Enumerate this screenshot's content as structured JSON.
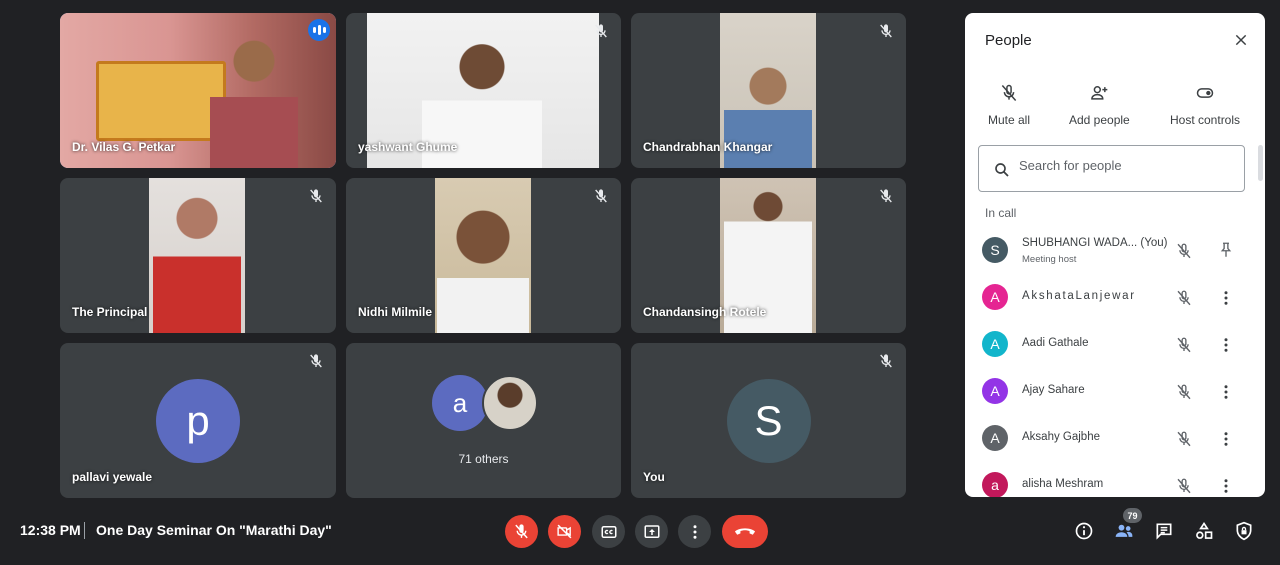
{
  "participants": [
    {
      "name": "Dr. Vilas G. Petkar",
      "speaking": true
    },
    {
      "name": "yashwant Ghume",
      "muted": true
    },
    {
      "name": "Chandrabhan Khangar",
      "muted": true
    },
    {
      "name": "The Principal",
      "muted": true
    },
    {
      "name": "Nidhi Milmile",
      "muted": true
    },
    {
      "name": "Chandansingh Rotele",
      "muted": true
    },
    {
      "name": "pallavi yewale",
      "muted": true,
      "avatar_letter": "p",
      "avatar_color": "#5c6bc0"
    },
    {
      "name": "71 others",
      "avatar_letter": "a",
      "avatar_color": "#5c6bc0"
    },
    {
      "name": "You",
      "muted": true,
      "avatar_letter": "S",
      "avatar_color": "#455a64"
    }
  ],
  "panel": {
    "title": "People",
    "mute_all": "Mute all",
    "add_people": "Add people",
    "host_controls": "Host controls",
    "search_placeholder": "Search for people",
    "section_label": "In call",
    "people": [
      {
        "letter": "S",
        "color": "#455a64",
        "name": "SHUBHANGI WADA...  (You)",
        "sub": "Meeting host"
      },
      {
        "letter": "A",
        "color": "#e52592",
        "name": "AkshataLanjewar"
      },
      {
        "letter": "A",
        "color": "#12b5cb",
        "name": "Aadi Gathale"
      },
      {
        "letter": "A",
        "color": "#9334e6",
        "name": "Ajay Sahare"
      },
      {
        "letter": "A",
        "color": "#5f6368",
        "name": "Aksahy Gajbhe"
      },
      {
        "letter": "a",
        "color": "#c2185b",
        "name": "alisha Meshram"
      }
    ]
  },
  "bottom": {
    "time": "12:38 PM",
    "meeting_title": "One Day Seminar On \"Marathi Day\"",
    "participant_count": "79"
  },
  "colors": {
    "background": "#202124",
    "tile": "#3c4043",
    "accent": "#8ab4f8",
    "danger": "#ea4335"
  }
}
